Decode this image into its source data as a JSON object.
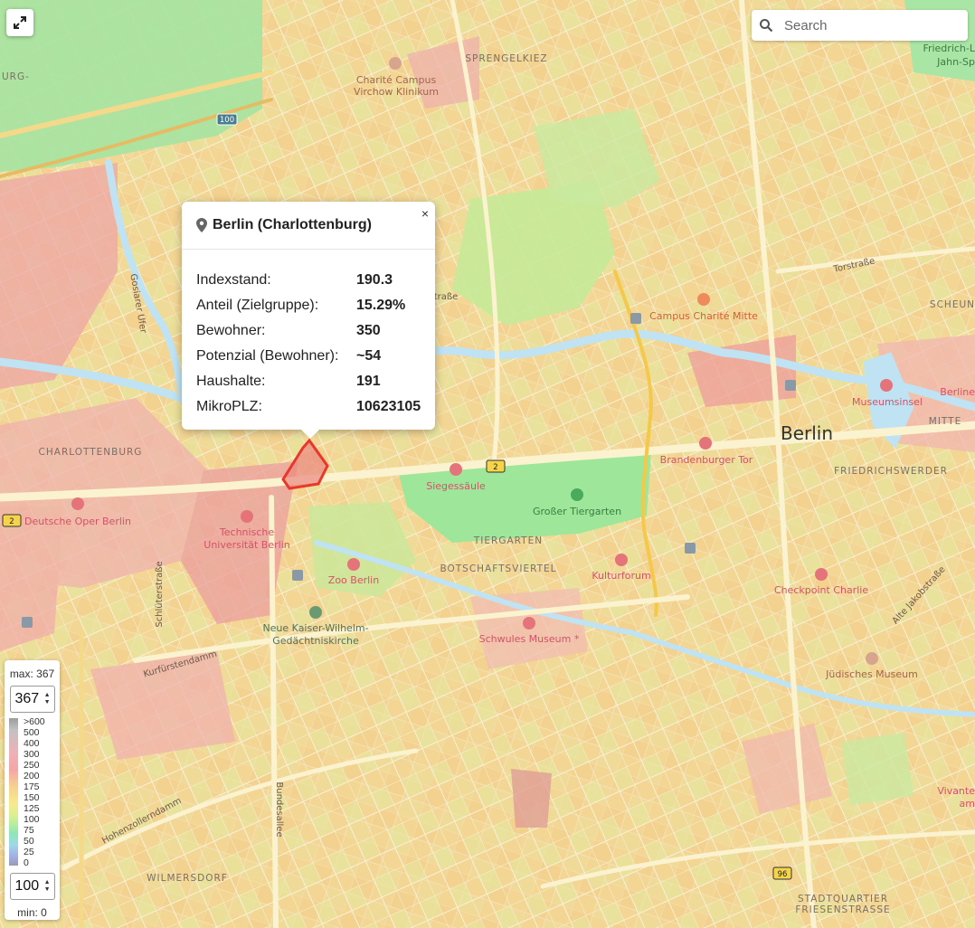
{
  "map": {
    "city_label": "Berlin",
    "district_labels": [
      "SPRENGELKIEZ",
      "CHARLOTTENBURG",
      "TIERGARTEN",
      "BOTSCHAFTSVIERTEL",
      "MITTE",
      "FRIEDRICHSWERDER",
      "WILMERSDORF",
      "STADTQUARTIER",
      "FRIESENSTRASSE",
      "SCHEUN",
      "URG-"
    ],
    "poi_labels": [
      "Charité Campus",
      "Virchow Klinikum",
      "Campus Charité Mitte",
      "Museumsinsel",
      "Brandenburger Tor",
      "Siegessäule",
      "Großer Tiergarten",
      "Deutsche Oper Berlin",
      "Technische",
      "Universität Berlin",
      "Zoo Berlin",
      "Kulturforum",
      "Checkpoint Charlie",
      "Neue Kaiser-Wilhelm-",
      "Gedächtniskirche",
      "Schwules Museum *",
      "Jüdisches Museum",
      "Friedrich-L",
      "Jahn-Sp",
      "Berline",
      "Vivante",
      "am"
    ],
    "street_labels": [
      "Torstraße",
      "Kurfürstendamm",
      "Hohenzollerndamm",
      "Bundesallee",
      "Schlüterstraße",
      "Alte Jakobstraße",
      "Gosiarer Ufer",
      "traße"
    ],
    "road_shields": [
      "100",
      "2",
      "2",
      "96"
    ],
    "colors": {
      "highlight": "#e8382c",
      "park": "#9ee79a",
      "water": "#bfe3f3",
      "base": "#f3e3a0",
      "poi_red": "#e4737a",
      "poi_green": "#4aab5c"
    }
  },
  "controls": {
    "fullscreen_icon": "expand-arrows-icon",
    "search_placeholder": "Search"
  },
  "popup": {
    "close": "×",
    "title": "Berlin (Charlottenburg)",
    "rows": [
      {
        "key": "Indexstand:",
        "value": "190.3"
      },
      {
        "key": "Anteil (Zielgruppe):",
        "value": "15.29%"
      },
      {
        "key": "Bewohner:",
        "value": "350"
      },
      {
        "key": "Potenzial (Bewohner):",
        "value": "~54"
      },
      {
        "key": "Haushalte:",
        "value": "191"
      },
      {
        "key": "MikroPLZ:",
        "value": "10623105"
      }
    ]
  },
  "legend": {
    "max_label": "max: 367",
    "max_value": "367",
    "ticks": [
      ">600",
      "500",
      "400",
      "300",
      "250",
      "200",
      "175",
      "150",
      "125",
      "100",
      "75",
      "50",
      "25",
      "0"
    ],
    "min_value": "100",
    "min_label": "min: 0"
  }
}
